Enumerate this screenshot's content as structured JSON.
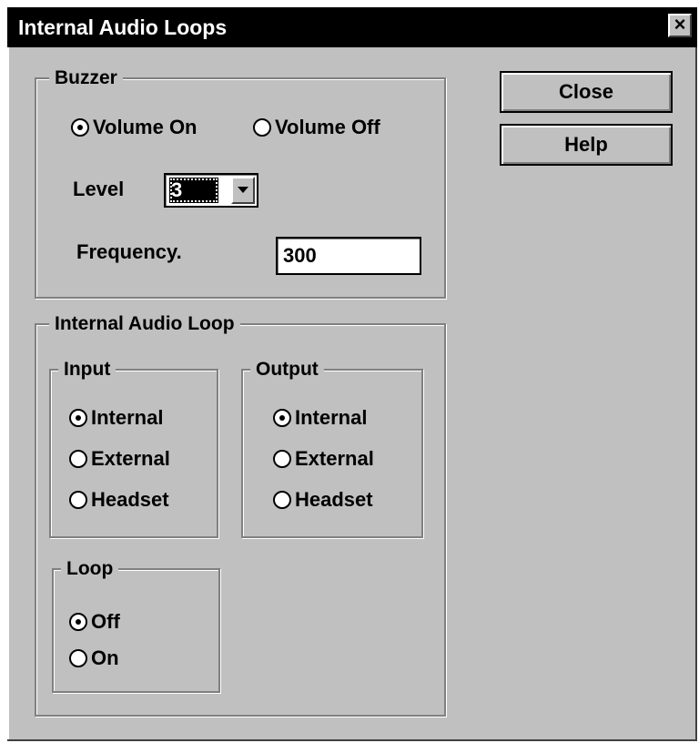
{
  "window": {
    "title": "Internal Audio Loops",
    "close_glyph": "×"
  },
  "buttons": {
    "close_label": "Close",
    "help_label": "Help"
  },
  "buzzer": {
    "title": "Buzzer",
    "volume_on_label": "Volume On",
    "volume_off_label": "Volume Off",
    "volume_selected": "Volume On",
    "level_label": "Level",
    "level_value": "3",
    "frequency_label": "Frequency.",
    "frequency_value": "300"
  },
  "internal_audio_loop": {
    "title": "Internal Audio Loop",
    "input": {
      "title": "Input",
      "options": [
        "Internal",
        "External",
        "Headset"
      ],
      "selected": "Internal"
    },
    "output": {
      "title": "Output",
      "options": [
        "Internal",
        "External",
        "Headset"
      ],
      "selected": "Internal"
    },
    "loop": {
      "title": "Loop",
      "options": [
        "Off",
        "On"
      ],
      "selected": "Off"
    }
  },
  "colors": {
    "dialog_bg": "#c0c0c0",
    "titlebar_bg": "#000000",
    "titlebar_text": "#ffffff"
  }
}
